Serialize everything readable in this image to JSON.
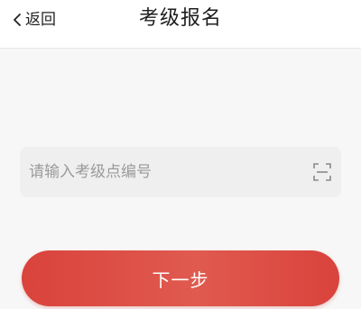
{
  "header": {
    "back_label": "返回",
    "title": "考级报名"
  },
  "form": {
    "site_input_placeholder": "请输入考级点编号",
    "site_input_value": ""
  },
  "actions": {
    "next_label": "下一步"
  },
  "icons": {
    "back": "chevron-left-icon",
    "scan": "scan-icon"
  },
  "colors": {
    "primary_button": "#d9433c",
    "input_background": "#efefef",
    "page_background": "#f8f7f7"
  }
}
